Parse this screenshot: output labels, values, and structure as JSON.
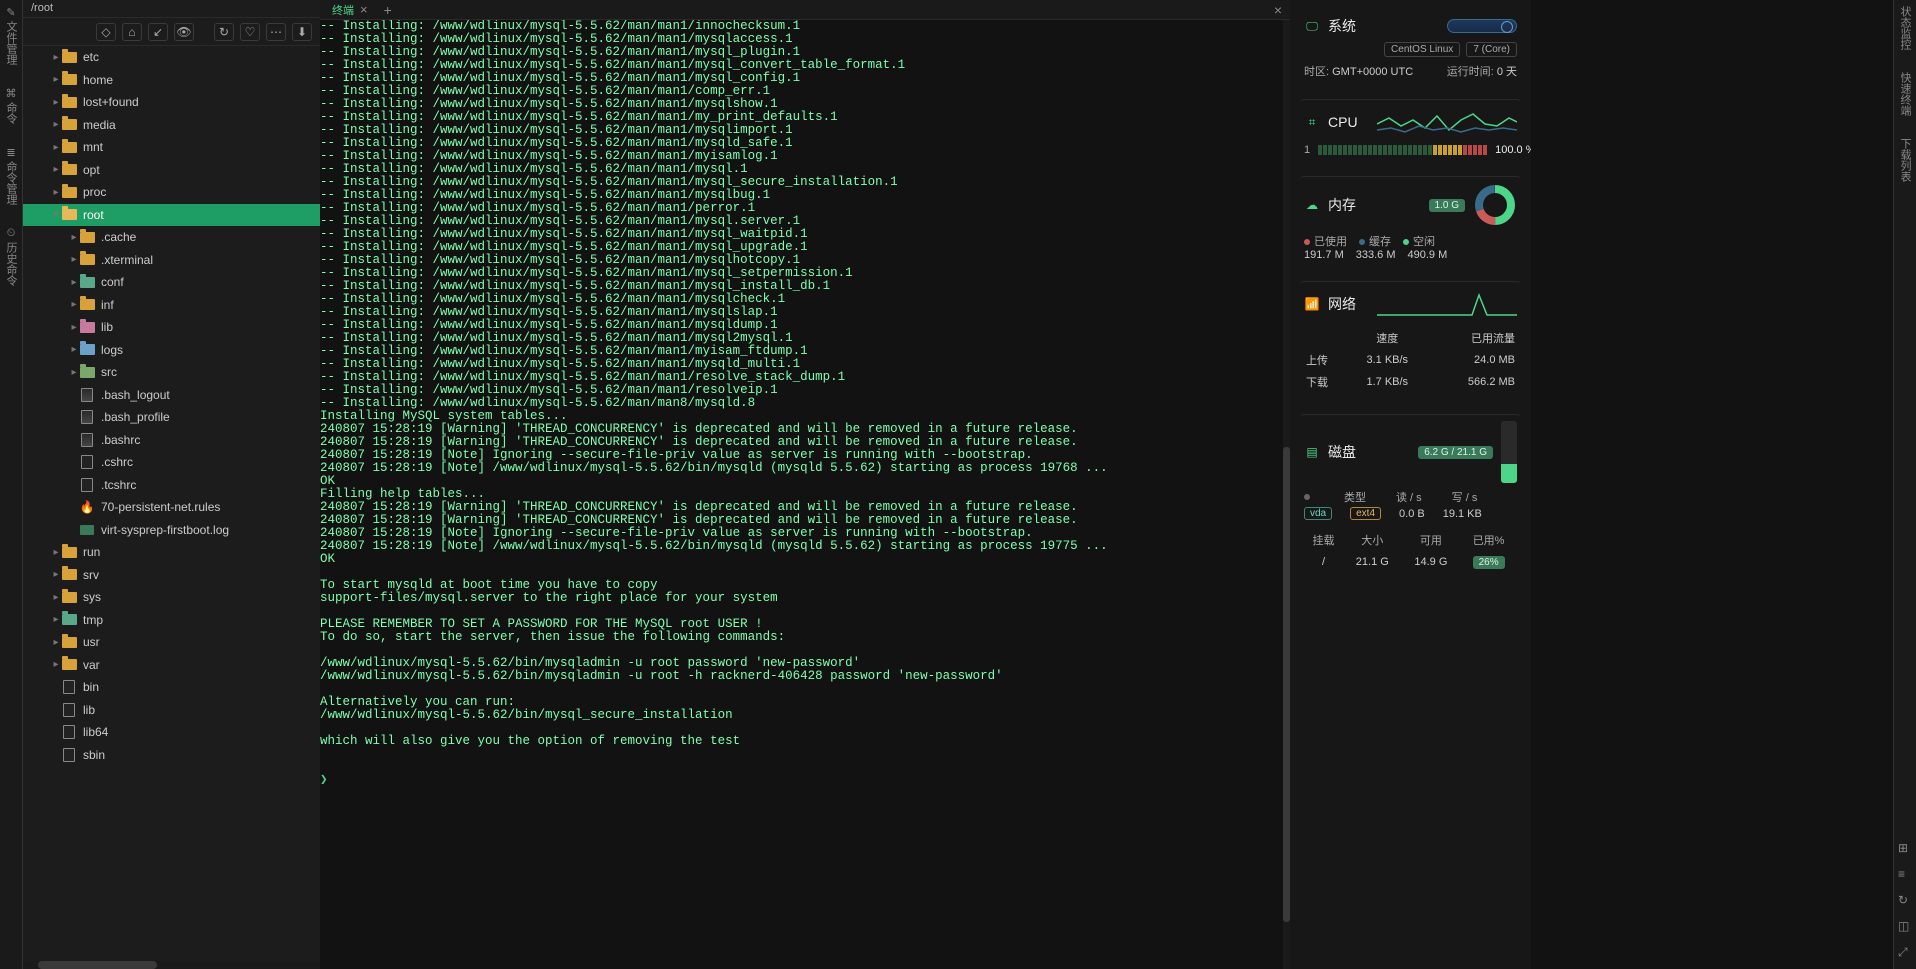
{
  "leftRail": [
    "文件管理",
    "命令",
    "命令管理",
    "历史命令"
  ],
  "rightRail": [
    "状态监控",
    "快速终端",
    "下载列表"
  ],
  "pathBar": "/root",
  "toolbarIcons": [
    "◇",
    "⌂",
    "↙",
    "👁",
    "↻",
    "♡",
    "⋯",
    "⬇"
  ],
  "fileTree": [
    {
      "indent": 1,
      "caret": "▸",
      "icon": "folder",
      "label": "etc"
    },
    {
      "indent": 1,
      "caret": "▸",
      "icon": "folder",
      "label": "home"
    },
    {
      "indent": 1,
      "caret": "▸",
      "icon": "folder",
      "label": "lost+found"
    },
    {
      "indent": 1,
      "caret": "▸",
      "icon": "folder",
      "label": "media"
    },
    {
      "indent": 1,
      "caret": "▸",
      "icon": "folder",
      "label": "mnt"
    },
    {
      "indent": 1,
      "caret": "▸",
      "icon": "folder",
      "label": "opt"
    },
    {
      "indent": 1,
      "caret": "▸",
      "icon": "folder",
      "label": "proc"
    },
    {
      "indent": 1,
      "caret": "▾",
      "icon": "folder-open",
      "label": "root",
      "selected": true
    },
    {
      "indent": 2,
      "caret": "▸",
      "icon": "folder",
      "label": ".cache"
    },
    {
      "indent": 2,
      "caret": "▸",
      "icon": "folder",
      "label": ".xterminal"
    },
    {
      "indent": 2,
      "caret": "▸",
      "icon": "folder-teal",
      "label": "conf"
    },
    {
      "indent": 2,
      "caret": "▸",
      "icon": "folder",
      "label": "inf"
    },
    {
      "indent": 2,
      "caret": "▸",
      "icon": "folder-pink",
      "label": "lib"
    },
    {
      "indent": 2,
      "caret": "▸",
      "icon": "folder-blue",
      "label": "logs"
    },
    {
      "indent": 2,
      "caret": "▸",
      "icon": "folder-green",
      "label": "src"
    },
    {
      "indent": 2,
      "caret": "",
      "icon": "file-sh",
      "label": ".bash_logout"
    },
    {
      "indent": 2,
      "caret": "",
      "icon": "file-sh",
      "label": ".bash_profile"
    },
    {
      "indent": 2,
      "caret": "",
      "icon": "file-sh",
      "label": ".bashrc"
    },
    {
      "indent": 2,
      "caret": "",
      "icon": "file-doc",
      "label": ".cshrc"
    },
    {
      "indent": 2,
      "caret": "",
      "icon": "file-doc",
      "label": ".tcshrc"
    },
    {
      "indent": 2,
      "caret": "",
      "icon": "file-flame",
      "label": "70-persistent-net.rules"
    },
    {
      "indent": 2,
      "caret": "",
      "icon": "file-log",
      "label": "virt-sysprep-firstboot.log"
    },
    {
      "indent": 1,
      "caret": "▸",
      "icon": "folder",
      "label": "run"
    },
    {
      "indent": 1,
      "caret": "▸",
      "icon": "folder",
      "label": "srv"
    },
    {
      "indent": 1,
      "caret": "▸",
      "icon": "folder",
      "label": "sys"
    },
    {
      "indent": 1,
      "caret": "▸",
      "icon": "folder-teal",
      "label": "tmp"
    },
    {
      "indent": 1,
      "caret": "▸",
      "icon": "folder",
      "label": "usr"
    },
    {
      "indent": 1,
      "caret": "▸",
      "icon": "folder",
      "label": "var"
    },
    {
      "indent": 1,
      "caret": "",
      "icon": "file-doc",
      "label": "bin"
    },
    {
      "indent": 1,
      "caret": "",
      "icon": "file-doc",
      "label": "lib"
    },
    {
      "indent": 1,
      "caret": "",
      "icon": "file-doc",
      "label": "lib64"
    },
    {
      "indent": 1,
      "caret": "",
      "icon": "file-doc",
      "label": "sbin"
    }
  ],
  "tabs": [
    {
      "label": "终端"
    }
  ],
  "terminal": {
    "install_prefix": "-- Installing: /www/wdlinux/mysql-5.5.62/man/man1/",
    "install_files": [
      "innochecksum.1",
      "mysqlaccess.1",
      "mysql_plugin.1",
      "mysql_convert_table_format.1",
      "mysql_config.1",
      "comp_err.1",
      "mysqlshow.1",
      "my_print_defaults.1",
      "mysqlimport.1",
      "mysqld_safe.1",
      "myisamlog.1",
      "mysql.1",
      "mysql_secure_installation.1",
      "mysqlbug.1",
      "perror.1",
      "mysql.server.1",
      "mysql_waitpid.1",
      "mysql_upgrade.1",
      "mysqlhotcopy.1",
      "mysql_setpermission.1",
      "mysql_install_db.1",
      "mysqlcheck.1",
      "mysqlslap.1",
      "mysqldump.1",
      "mysql2mysql.1",
      "myisam_ftdump.1",
      "mysqld_multi.1",
      "resolve_stack_dump.1",
      "resolveip.1"
    ],
    "install_last": "-- Installing: /www/wdlinux/mysql-5.5.62/man/man8/mysqld.8",
    "body_lines": [
      "Installing MySQL system tables...",
      "240807 15:28:19 [Warning] 'THREAD_CONCURRENCY' is deprecated and will be removed in a future release.",
      "240807 15:28:19 [Warning] 'THREAD_CONCURRENCY' is deprecated and will be removed in a future release.",
      "240807 15:28:19 [Note] Ignoring --secure-file-priv value as server is running with --bootstrap.",
      "240807 15:28:19 [Note] /www/wdlinux/mysql-5.5.62/bin/mysqld (mysqld 5.5.62) starting as process 19768 ...",
      "OK",
      "Filling help tables...",
      "240807 15:28:19 [Warning] 'THREAD_CONCURRENCY' is deprecated and will be removed in a future release.",
      "240807 15:28:19 [Warning] 'THREAD_CONCURRENCY' is deprecated and will be removed in a future release.",
      "240807 15:28:19 [Note] Ignoring --secure-file-priv value as server is running with --bootstrap.",
      "240807 15:28:19 [Note] /www/wdlinux/mysql-5.5.62/bin/mysqld (mysqld 5.5.62) starting as process 19775 ...",
      "OK",
      "",
      "To start mysqld at boot time you have to copy",
      "support-files/mysql.server to the right place for your system",
      "",
      "PLEASE REMEMBER TO SET A PASSWORD FOR THE MySQL root USER !",
      "To do so, start the server, then issue the following commands:",
      "",
      "/www/wdlinux/mysql-5.5.62/bin/mysqladmin -u root password 'new-password'",
      "/www/wdlinux/mysql-5.5.62/bin/mysqladmin -u root -h racknerd-406428 password 'new-password'",
      "",
      "Alternatively you can run:",
      "/www/wdlinux/mysql-5.5.62/bin/mysql_secure_installation",
      "",
      "which will also give you the option of removing the test"
    ],
    "prompt": "❯"
  },
  "dashboard": {
    "system": {
      "title": "系统",
      "os": "CentOS Linux",
      "core": "7 (Core)",
      "tz_label": "时区:",
      "tz": "GMT+0000",
      "tzzone": "UTC",
      "uptime_label": "运行时间:",
      "uptime": "0 天"
    },
    "cpu": {
      "title": "CPU",
      "cores": "1",
      "percent": "100.0 %"
    },
    "memory": {
      "title": "内存",
      "total_tag": "1.0 G",
      "legend": {
        "used": "已使用",
        "cache": "缓存",
        "free": "空闲"
      },
      "used": "191.7 M",
      "cache": "333.6 M",
      "free": "490.9 M"
    },
    "network": {
      "title": "网络",
      "cols": {
        "speed": "速度",
        "traffic": "已用流量"
      },
      "rows": [
        {
          "label": "上传",
          "speed": "3.1 KB/s",
          "traffic": "24.0 MB"
        },
        {
          "label": "下载",
          "speed": "1.7 KB/s",
          "traffic": "566.2 MB"
        }
      ]
    },
    "disk": {
      "title": "磁盘",
      "usage_tag": "6.2 G / 21.1 G",
      "dev": {
        "name": "vda",
        "fs": "ext4"
      },
      "cols": {
        "type": "类型",
        "read": "读 / s",
        "write": "写 / s"
      },
      "rw": {
        "read": "0.0 B",
        "write": "19.1 KB"
      },
      "table": {
        "head": {
          "mount": "挂载",
          "size": "大小",
          "avail": "可用",
          "used": "已用%"
        },
        "row": {
          "mount": "/",
          "size": "21.1 G",
          "avail": "14.9 G",
          "used": "26%"
        }
      },
      "fill_pct": 30
    }
  }
}
